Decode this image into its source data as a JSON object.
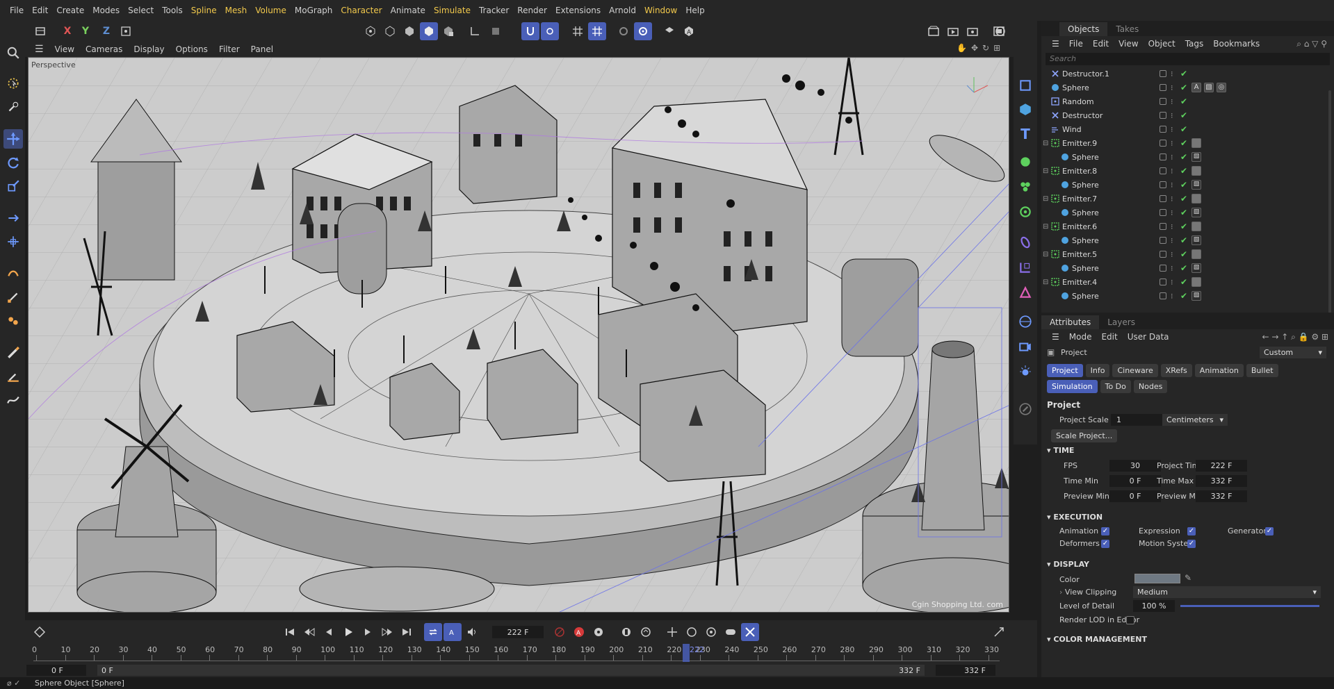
{
  "menu": [
    "File",
    "Edit",
    "Create",
    "Modes",
    "Select",
    "Tools",
    "Spline",
    "Mesh",
    "Volume",
    "MoGraph",
    "Character",
    "Animate",
    "Simulate",
    "Tracker",
    "Render",
    "Extensions",
    "Arnold",
    "Window",
    "Help"
  ],
  "axis": {
    "x": "X",
    "y": "Y",
    "z": "Z"
  },
  "viewport_menu": [
    "View",
    "Cameras",
    "Display",
    "Options",
    "Filter",
    "Panel"
  ],
  "viewport": {
    "camera": "Perspective",
    "watermark": "Cgin Shopping Ltd. com"
  },
  "objects_tabs": [
    "Objects",
    "Takes"
  ],
  "objects_menu": [
    "File",
    "Edit",
    "View",
    "Object",
    "Tags",
    "Bookmarks"
  ],
  "search_placeholder": "Search",
  "objects": [
    {
      "name": "Destructor.1",
      "icon": "destructor-icon",
      "indent": 0
    },
    {
      "name": "Sphere",
      "icon": "sphere-icon",
      "indent": 0
    },
    {
      "name": "Random",
      "icon": "random-icon",
      "indent": 0
    },
    {
      "name": "Destructor",
      "icon": "destructor-icon",
      "indent": 0
    },
    {
      "name": "Wind",
      "icon": "wind-icon",
      "indent": 0
    },
    {
      "name": "Emitter.9",
      "icon": "emitter-icon",
      "indent": 0
    },
    {
      "name": "Sphere",
      "icon": "sphere-icon",
      "indent": 1
    },
    {
      "name": "Emitter.8",
      "icon": "emitter-icon",
      "indent": 0
    },
    {
      "name": "Sphere",
      "icon": "sphere-icon",
      "indent": 1
    },
    {
      "name": "Emitter.7",
      "icon": "emitter-icon",
      "indent": 0
    },
    {
      "name": "Sphere",
      "icon": "sphere-icon",
      "indent": 1
    },
    {
      "name": "Emitter.6",
      "icon": "emitter-icon",
      "indent": 0
    },
    {
      "name": "Sphere",
      "icon": "sphere-icon",
      "indent": 1
    },
    {
      "name": "Emitter.5",
      "icon": "emitter-icon",
      "indent": 0
    },
    {
      "name": "Sphere",
      "icon": "sphere-icon",
      "indent": 1
    },
    {
      "name": "Emitter.4",
      "icon": "emitter-icon",
      "indent": 0
    },
    {
      "name": "Sphere",
      "icon": "sphere-icon",
      "indent": 1
    }
  ],
  "attr_tabs": [
    "Attributes",
    "Layers"
  ],
  "attr_menu": [
    "Mode",
    "Edit",
    "User Data"
  ],
  "project_label": "Project",
  "preset": "Custom",
  "attr_buttons": [
    "Project",
    "Info",
    "Cineware",
    "XRefs",
    "Animation",
    "Bullet",
    "Simulation",
    "To Do",
    "Nodes"
  ],
  "project": {
    "title": "Project",
    "scale_label": "Project Scale",
    "scale_value": "1",
    "scale_unit": "Centimeters",
    "scale_button": "Scale Project..."
  },
  "time": {
    "title": "TIME",
    "fps_label": "FPS",
    "fps": "30",
    "ptime_label": "Project Time",
    "ptime": "222 F",
    "tmin_label": "Time Min",
    "tmin": "0 F",
    "tmax_label": "Time Max",
    "tmax": "332 F",
    "pmin_label": "Preview Min",
    "pmin": "0 F",
    "pmax_label": "Preview Max",
    "pmax": "332 F"
  },
  "execution": {
    "title": "EXECUTION",
    "animation": "Animation",
    "expression": "Expression",
    "generators": "Generators",
    "deformers": "Deformers",
    "motion": "Motion System"
  },
  "display": {
    "title": "DISPLAY",
    "color": "Color",
    "clipping": "View Clipping",
    "clipping_value": "Medium",
    "lod": "Level of Detail",
    "lod_value": "100 %",
    "render_lod": "Render LOD in Editor"
  },
  "color_mgmt": "COLOR MANAGEMENT",
  "timeline": {
    "current_frame": "222 F",
    "start": "0 F",
    "start2": "0 F",
    "end": "332 F",
    "end2": "332 F",
    "playhead": "222",
    "ticks": [
      0,
      10,
      20,
      30,
      40,
      50,
      60,
      70,
      80,
      90,
      100,
      110,
      120,
      130,
      140,
      150,
      160,
      170,
      180,
      190,
      200,
      210,
      220,
      230,
      240,
      250,
      260,
      270,
      280,
      290,
      300,
      310,
      320,
      330
    ]
  },
  "status": "Sphere Object [Sphere]",
  "colors": {
    "accent": "#4a5fb8",
    "check": "#5ed15e",
    "highlight": "#f2c94c"
  }
}
